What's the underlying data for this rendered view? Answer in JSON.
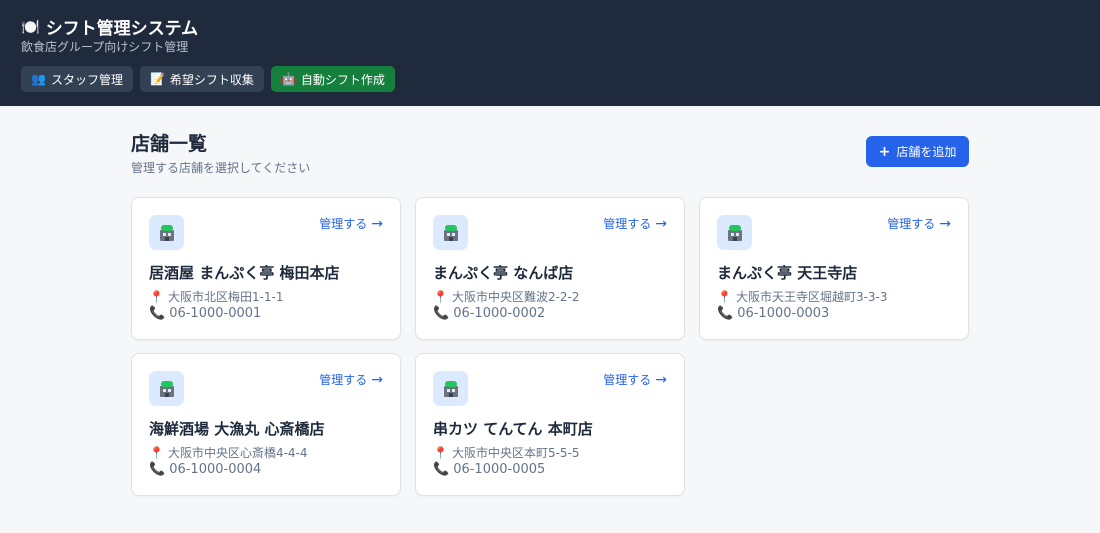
{
  "app": {
    "title": "シフト管理システム",
    "title_icon": "plate-cutlery-icon",
    "subtitle": "飲食店グループ向けシフト管理"
  },
  "nav": {
    "items": [
      {
        "label": "スタッフ管理",
        "icon": "people-icon",
        "active": false
      },
      {
        "label": "希望シフト収集",
        "icon": "memo-icon",
        "active": false
      },
      {
        "label": "自動シフト作成",
        "icon": "robot-icon",
        "active": true
      }
    ]
  },
  "page": {
    "title": "店舗一覧",
    "subtitle": "管理する店舗を選択してください",
    "add_button": "店舗を追加"
  },
  "stores": [
    {
      "name": "居酒屋 まんぷく亭 梅田本店",
      "address": "大阪市北区梅田1-1-1",
      "phone": "06-1000-0001",
      "manage": "管理する"
    },
    {
      "name": "まんぷく亭 なんば店",
      "address": "大阪市中央区難波2-2-2",
      "phone": "06-1000-0002",
      "manage": "管理する"
    },
    {
      "name": "まんぷく亭 天王寺店",
      "address": "大阪市天王寺区堀越町3-3-3",
      "phone": "06-1000-0003",
      "manage": "管理する"
    },
    {
      "name": "海鮮酒場 大漁丸 心斎橋店",
      "address": "大阪市中央区心斎橋4-4-4",
      "phone": "06-1000-0004",
      "manage": "管理する"
    },
    {
      "name": "串カツ てんてん 本町店",
      "address": "大阪市中央区本町5-5-5",
      "phone": "06-1000-0005",
      "manage": "管理する"
    }
  ],
  "colors": {
    "header_bg": "#1f2a3c",
    "nav_btn_bg": "#334155",
    "nav_active_bg": "#15803d",
    "accent": "#2563eb",
    "page_bg": "#f6f7f9"
  }
}
